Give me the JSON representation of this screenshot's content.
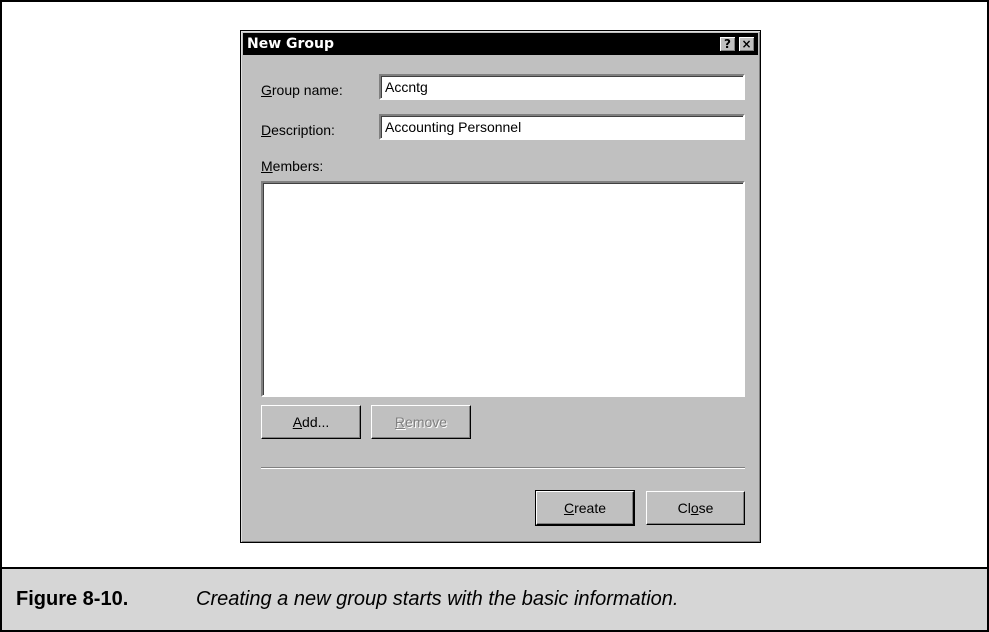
{
  "dialog": {
    "title": "New Group",
    "help_button": "?",
    "close_button": "×",
    "group_name_label_u": "G",
    "group_name_label_rest": "roup name:",
    "group_name_value": "Accntg",
    "description_label_u": "D",
    "description_label_rest": "escription:",
    "description_value": "Accounting Personnel",
    "members_label_u": "M",
    "members_label_rest": "embers:",
    "add_button_u": "A",
    "add_button_rest": "dd...",
    "remove_button_u": "R",
    "remove_button_rest": "emove",
    "create_button_u": "C",
    "create_button_rest": "reate",
    "close_btn_pre": "Cl",
    "close_btn_u": "o",
    "close_btn_post": "se"
  },
  "caption": {
    "label": "Figure 8-10.",
    "text": "Creating a new group starts with the basic information."
  }
}
